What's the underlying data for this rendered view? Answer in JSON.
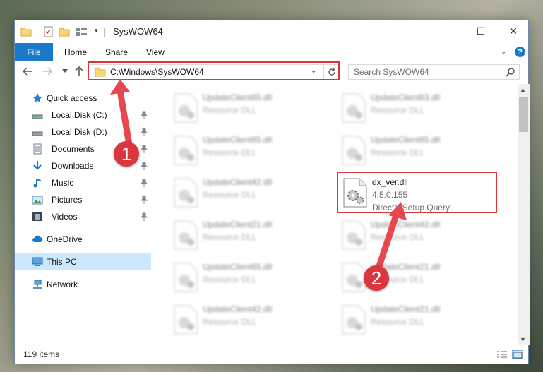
{
  "window": {
    "title": "SysWOW64",
    "controls": {
      "minimize": "—",
      "maximize": "☐",
      "close": "✕"
    }
  },
  "ribbon": {
    "tabs": [
      "File",
      "Home",
      "Share",
      "View"
    ],
    "help": "?"
  },
  "navigation": {
    "address": "C:\\Windows\\SysWOW64",
    "search_placeholder": "Search SysWOW64"
  },
  "sidebar": {
    "items": [
      {
        "label": "Quick access",
        "icon": "star-icon",
        "pinned": false
      },
      {
        "label": "Local Disk (C:)",
        "icon": "drive-icon",
        "pinned": true
      },
      {
        "label": "Local Disk (D:)",
        "icon": "drive-icon",
        "pinned": true
      },
      {
        "label": "Documents",
        "icon": "documents-icon",
        "pinned": true
      },
      {
        "label": "Downloads",
        "icon": "downloads-icon",
        "pinned": true
      },
      {
        "label": "Music",
        "icon": "music-icon",
        "pinned": true
      },
      {
        "label": "Pictures",
        "icon": "pictures-icon",
        "pinned": true
      },
      {
        "label": "Videos",
        "icon": "videos-icon",
        "pinned": true
      },
      {
        "label": "OneDrive",
        "icon": "cloud-icon",
        "pinned": false
      },
      {
        "label": "This PC",
        "icon": "computer-icon",
        "pinned": false,
        "selected": true
      },
      {
        "label": "Network",
        "icon": "network-icon",
        "pinned": false
      }
    ]
  },
  "files": [
    {
      "name": "UpdateClient65.dll",
      "type": "Resource DLL"
    },
    {
      "name": "UpdateClient63.dll",
      "type": "Resource DLL"
    },
    {
      "name": "UpdateClient65.dll",
      "type": "Resource DLL"
    },
    {
      "name": "UpdateClient65.dll",
      "type": "Resource DLL"
    },
    {
      "name": "UpdateClient42.dll",
      "type": "Resource DLL"
    },
    {
      "name": "dx_ver.dll",
      "version": "4.5.0.155",
      "description": "DirectX Setup Query..."
    },
    {
      "name": "UpdateClient21.dll",
      "type": "Resource DLL"
    },
    {
      "name": "UpdateClient42.dll",
      "type": "Resource DLL"
    },
    {
      "name": "UpdateClient65.dll",
      "type": "Resource DLL"
    },
    {
      "name": "UpdateClient21.dll",
      "type": "Resource DLL"
    },
    {
      "name": "UpdateClient42.dll",
      "type": "Resource DLL"
    },
    {
      "name": "UpdateClient21.dll",
      "type": "Resource DLL"
    }
  ],
  "status": {
    "item_count": "119 items"
  },
  "callouts": {
    "one": "1",
    "two": "2"
  },
  "colors": {
    "accent": "#1979ca",
    "highlight": "#d9363e",
    "selection": "#cce8ff"
  }
}
